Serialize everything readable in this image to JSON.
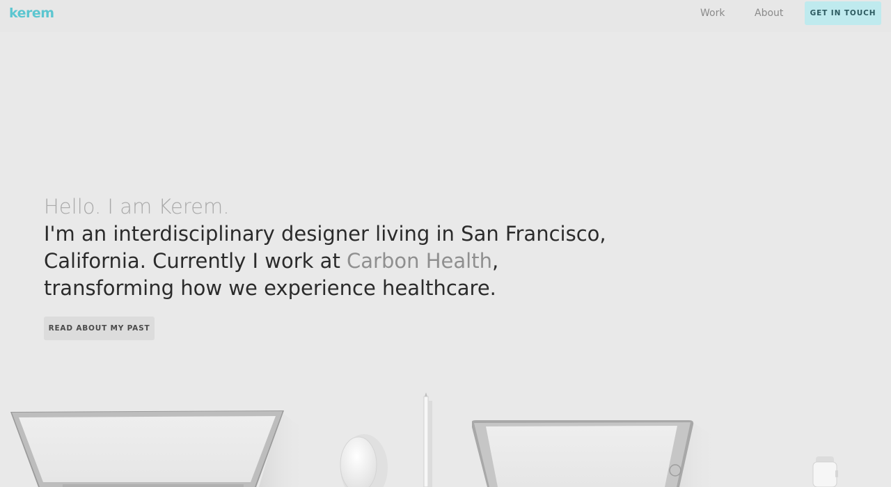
{
  "header": {
    "logo": "kerem",
    "nav": {
      "work": "Work",
      "about": "About"
    },
    "cta_label": "GET IN TOUCH"
  },
  "hero": {
    "greeting": "Hello. I am Kerem.",
    "intro_line1": "I'm an interdisciplinary designer living in San Francisco,",
    "intro_line2_prefix": "California. Currently I work at ",
    "company": "Carbon Health",
    "intro_line2_suffix": ",",
    "intro_line3": "transforming how we experience healthcare.",
    "button_label": "READ ABOUT MY PAST"
  },
  "illustration": {
    "items": [
      "laptop",
      "mouse",
      "pencil",
      "tablet",
      "watch"
    ]
  },
  "colors": {
    "accent": "#5cc6d0",
    "cta_background": "#bfeaee",
    "background": "#e9e9e9"
  }
}
